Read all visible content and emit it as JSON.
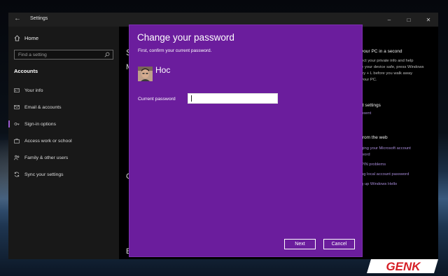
{
  "window": {
    "title": "Settings",
    "controls": [
      "minimize",
      "maximize",
      "close"
    ]
  },
  "sidebar": {
    "home_label": "Home",
    "search_placeholder": "Find a setting",
    "section_title": "Accounts",
    "items": [
      {
        "label": "Your info",
        "icon": "person-card-icon"
      },
      {
        "label": "Email & accounts",
        "icon": "mail-icon"
      },
      {
        "label": "Sign-in options",
        "icon": "key-icon",
        "active": true
      },
      {
        "label": "Access work or school",
        "icon": "briefcase-icon"
      },
      {
        "label": "Family & other users",
        "icon": "users-icon"
      },
      {
        "label": "Sync your settings",
        "icon": "sync-icon"
      }
    ]
  },
  "main": {
    "letters": [
      "S",
      "M",
      "C",
      "E"
    ]
  },
  "right_panel": {
    "heading1": "your PC in a second",
    "p1": [
      "ect your private info and help",
      "e your device safe, press Windows",
      "ey + L before you walk away",
      "your PC."
    ],
    "heading2": "d settings",
    "link2": "nsent",
    "heading3": "from the web",
    "links3": [
      "ging your Microsoft account",
      "word",
      "PIN problems",
      "ng local account password",
      "g up Windows Hello"
    ]
  },
  "dialog": {
    "title": "Change your password",
    "subtitle": "First, confirm your current password.",
    "user_name": "Hoc",
    "password_label": "Current password",
    "password_value": "",
    "next_label": "Next",
    "cancel_label": "Cancel"
  },
  "watermark": {
    "text": "GENK"
  },
  "colors": {
    "dialog_bg": "#6b1d9d",
    "accent": "#9b59d0",
    "link": "#a78bd8"
  }
}
